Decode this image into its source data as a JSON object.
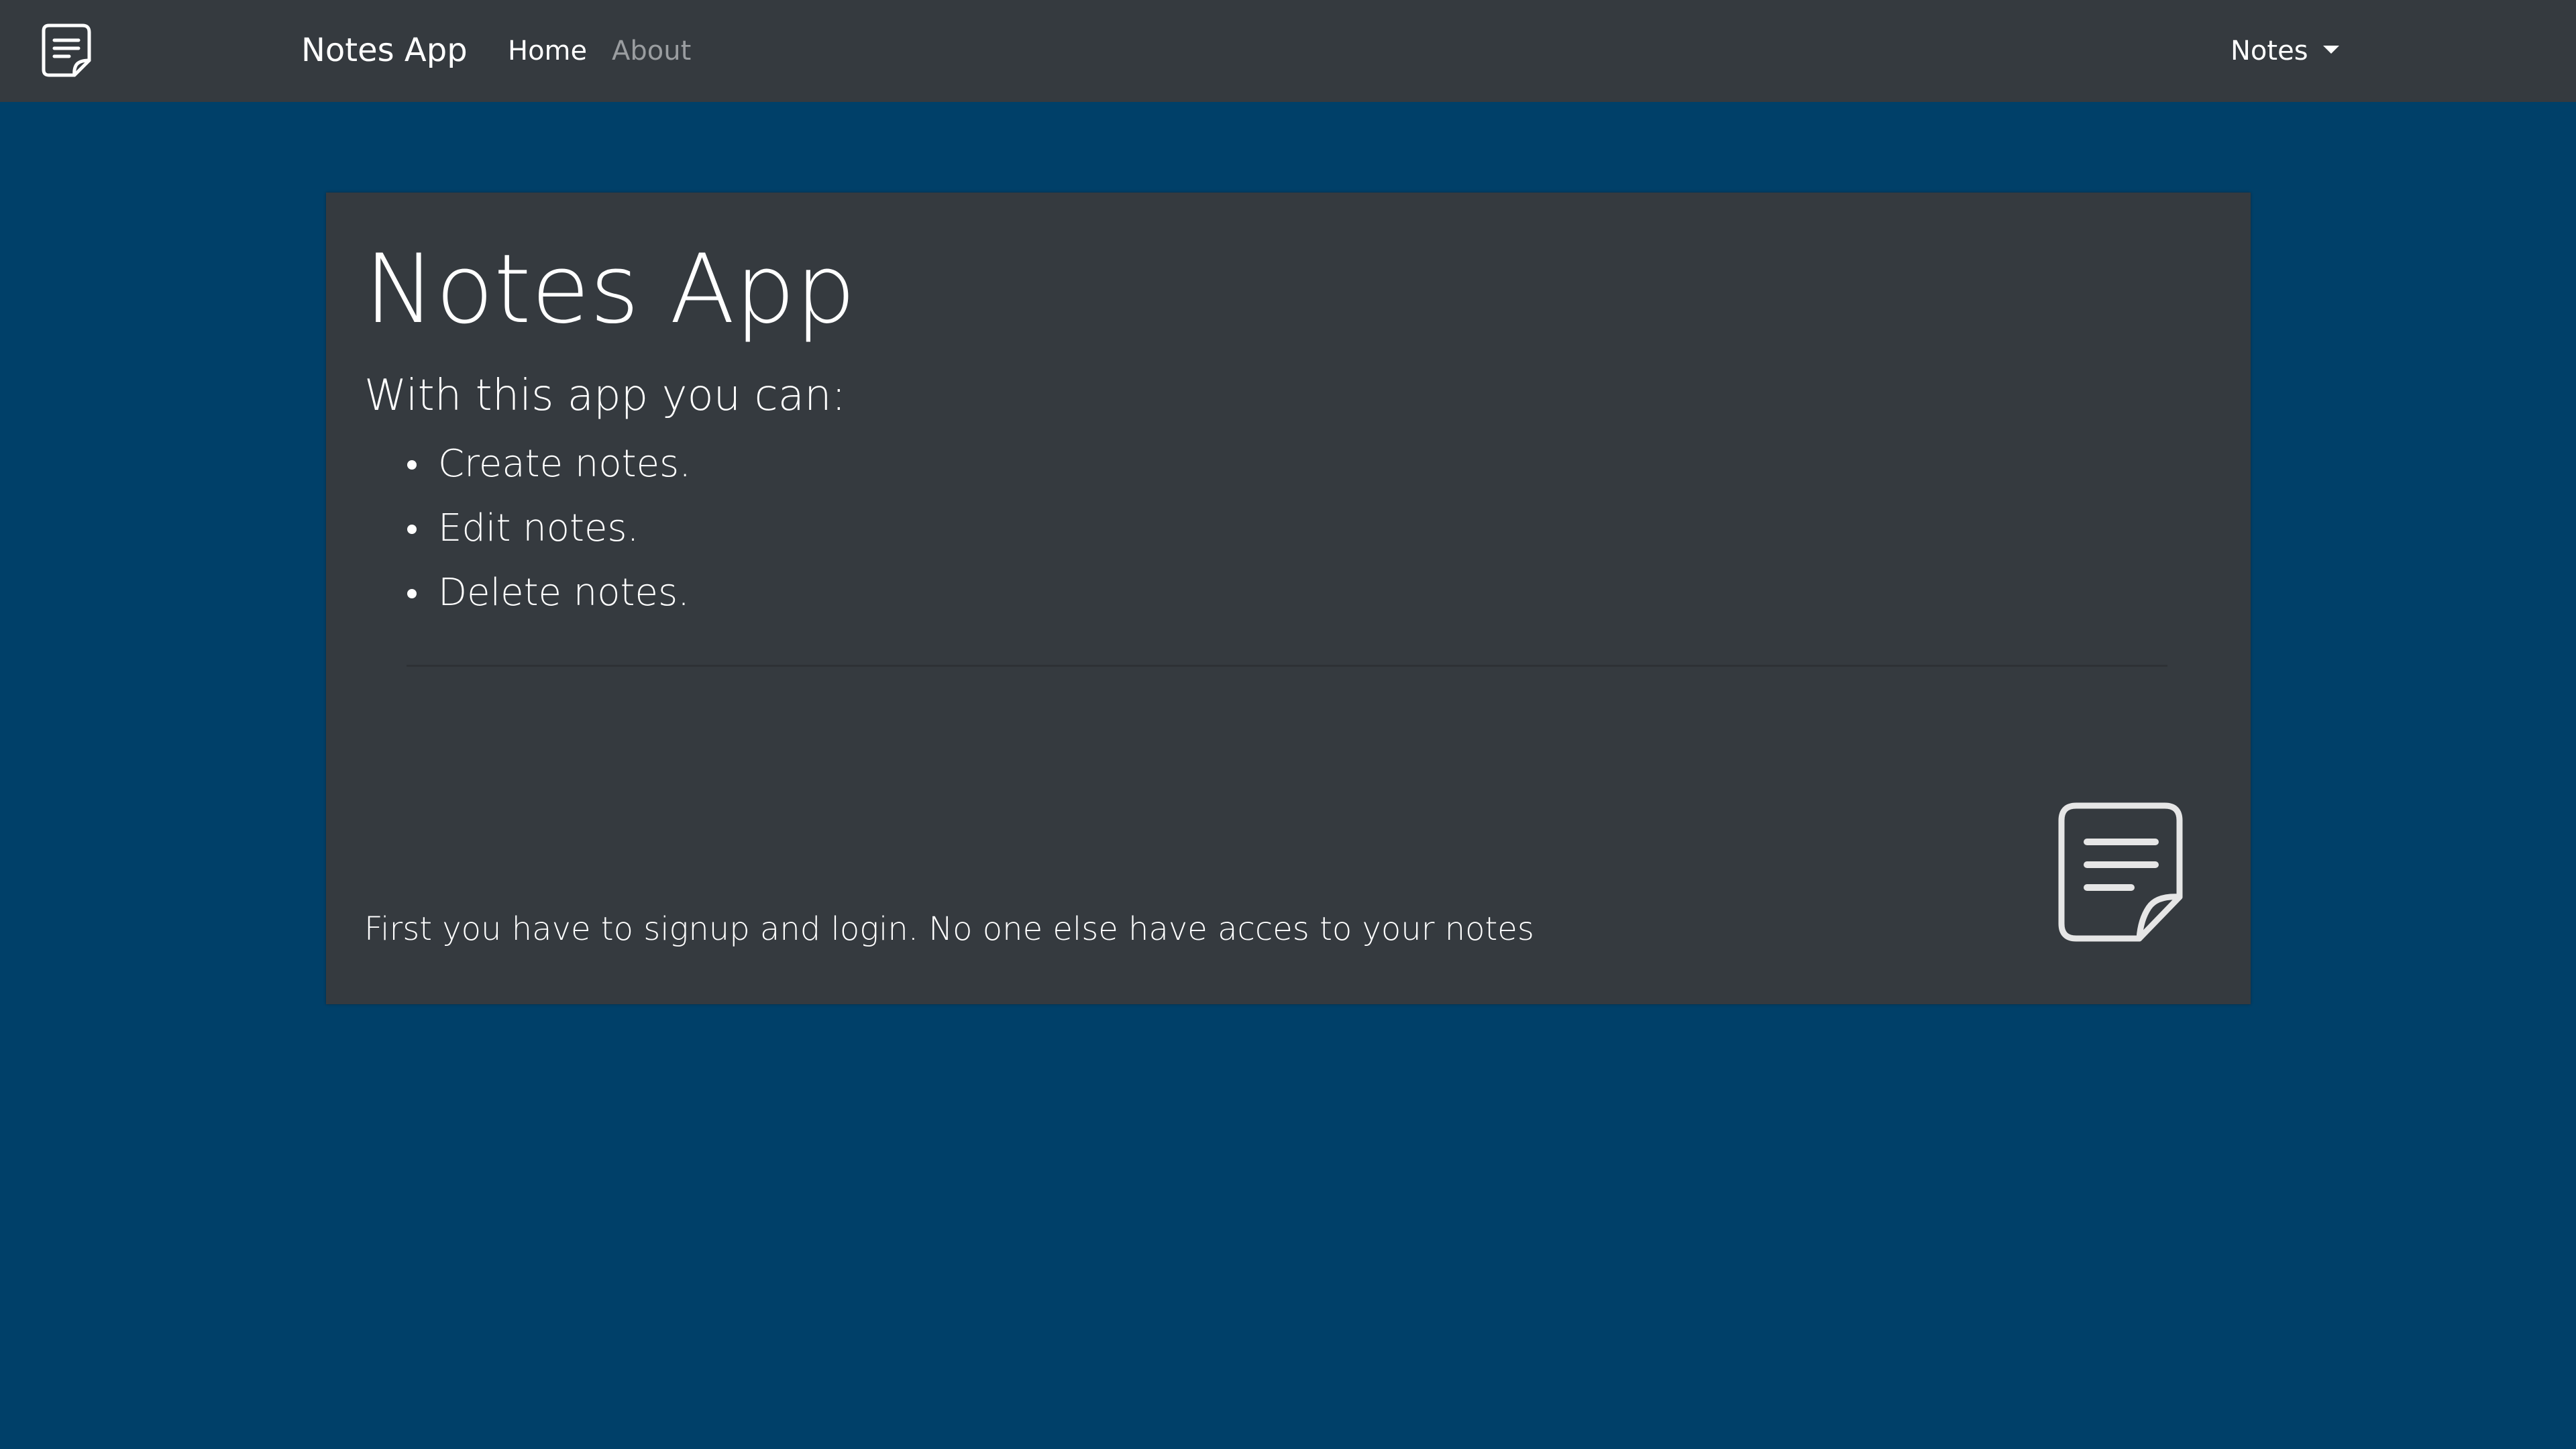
{
  "navbar": {
    "logo_icon": "note-icon",
    "brand": "Notes App",
    "links": [
      {
        "label": "Home",
        "active": true
      },
      {
        "label": "About",
        "active": false
      }
    ],
    "dropdown_label": "Notes"
  },
  "main": {
    "title": "Notes App",
    "subtitle": "With this app you can:",
    "features": [
      "Create notes.",
      "Edit notes.",
      "Delete notes."
    ],
    "description": "First you have to signup and login. No one else have acces to your notes",
    "icon": "note-icon"
  },
  "colors": {
    "background": "#004069",
    "surface": "#353a3f",
    "text": "#ffffff",
    "muted_link": "#9a9da0"
  }
}
